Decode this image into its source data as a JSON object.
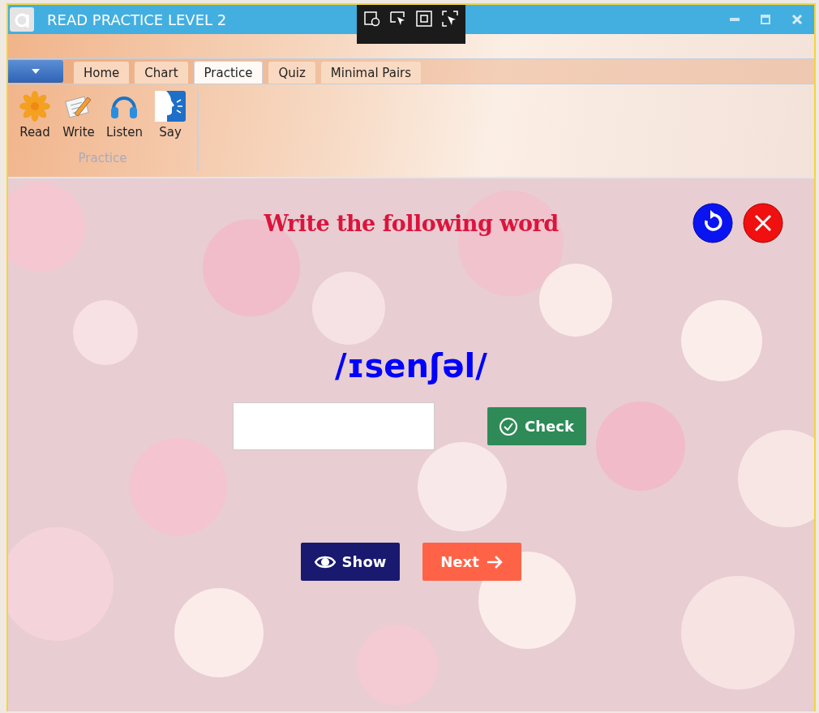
{
  "window": {
    "title": "READ PRACTICE LEVEL 2"
  },
  "tabs": [
    {
      "label": "Home",
      "selected": false
    },
    {
      "label": "Chart",
      "selected": false
    },
    {
      "label": "Practice",
      "selected": true
    },
    {
      "label": "Quiz",
      "selected": false
    },
    {
      "label": "Minimal Pairs",
      "selected": false
    }
  ],
  "ribbon_group": {
    "label": "Practice",
    "buttons": [
      {
        "label": "Read",
        "kind": "read"
      },
      {
        "label": "Write",
        "kind": "write"
      },
      {
        "label": "Listen",
        "kind": "listen"
      },
      {
        "label": "Say",
        "kind": "say"
      }
    ]
  },
  "exercise": {
    "heading": "Write the following word",
    "phonetic": "/ɪsenʃəl/",
    "check_button": "Check",
    "show_button": "Show",
    "next_button": "Next"
  }
}
